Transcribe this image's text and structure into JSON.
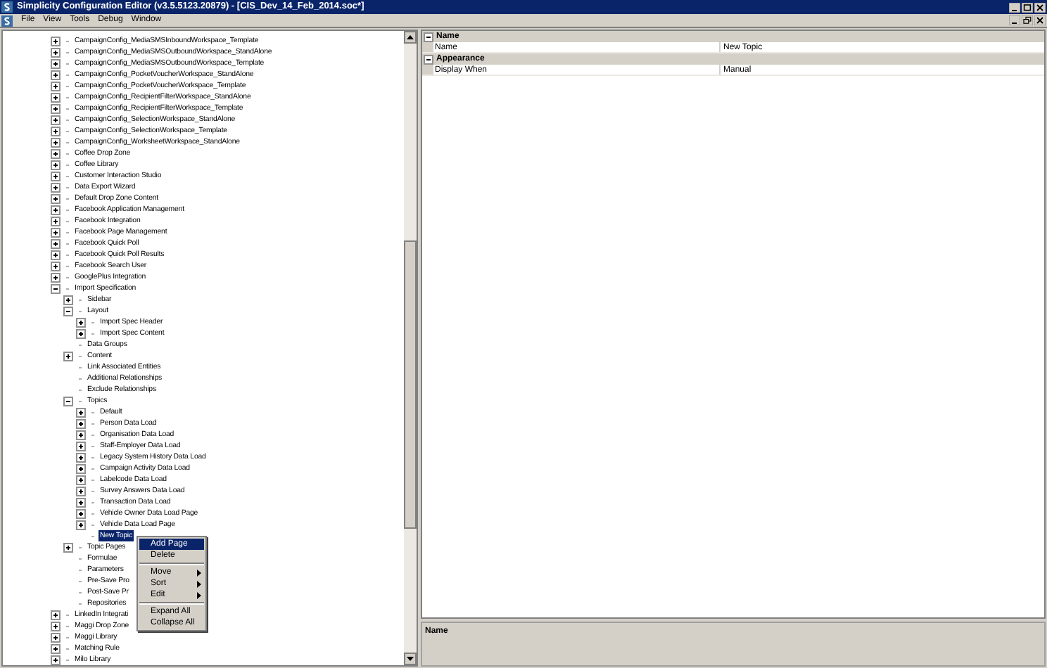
{
  "window": {
    "title": "Simplicity Configuration Editor (v3.5.5123.20879) - [CIS_Dev_14_Feb_2014.soc*]"
  },
  "menu": [
    "File",
    "View",
    "Tools",
    "Debug",
    "Window"
  ],
  "tree": [
    {
      "label": "CampaignConfig_MediaSMSInboundWorkspace_Template",
      "expanded": false,
      "selected": false
    },
    {
      "label": "CampaignConfig_MediaSMSOutboundWorkspace_StandAlone",
      "expanded": false,
      "selected": false
    },
    {
      "label": "CampaignConfig_MediaSMSOutboundWorkspace_Template",
      "expanded": false,
      "selected": false
    },
    {
      "label": "CampaignConfig_PocketVoucherWorkspace_StandAlone",
      "expanded": false,
      "selected": false
    },
    {
      "label": "CampaignConfig_PocketVoucherWorkspace_Template",
      "expanded": false,
      "selected": false
    },
    {
      "label": "CampaignConfig_RecipientFilterWorkspace_StandAlone",
      "expanded": false,
      "selected": false
    },
    {
      "label": "CampaignConfig_RecipientFilterWorkspace_Template",
      "expanded": false,
      "selected": false
    },
    {
      "label": "CampaignConfig_SelectionWorkspace_StandAlone",
      "expanded": false,
      "selected": false
    },
    {
      "label": "CampaignConfig_SelectionWorkspace_Template",
      "expanded": false,
      "selected": false
    },
    {
      "label": "CampaignConfig_WorksheetWorkspace_StandAlone",
      "expanded": false,
      "selected": false
    },
    {
      "label": "Coffee Drop Zone",
      "expanded": false,
      "selected": false
    },
    {
      "label": "Coffee Library",
      "expanded": false,
      "selected": false
    },
    {
      "label": "Customer Interaction Studio",
      "expanded": false,
      "selected": false
    },
    {
      "label": "Data Export Wizard",
      "expanded": false,
      "selected": false
    },
    {
      "label": "Default Drop Zone Content",
      "expanded": false,
      "selected": false
    },
    {
      "label": "Facebook Application Management",
      "expanded": false,
      "selected": false
    },
    {
      "label": "Facebook Integration",
      "expanded": false,
      "selected": false
    },
    {
      "label": "Facebook Page Management",
      "expanded": false,
      "selected": false
    },
    {
      "label": "Facebook Quick Poll",
      "expanded": false,
      "selected": false
    },
    {
      "label": "Facebook Quick Poll Results",
      "expanded": false,
      "selected": false
    },
    {
      "label": "Facebook Search User",
      "expanded": false,
      "selected": false
    },
    {
      "label": "GooglePlus Integration",
      "expanded": false,
      "selected": false
    },
    {
      "label": "Import Specification",
      "expanded": true,
      "selected": false,
      "children": [
        {
          "label": "Sidebar",
          "expanded": false,
          "selected": false
        },
        {
          "label": "Layout",
          "expanded": true,
          "selected": false,
          "children": [
            {
              "label": "Import Spec Header",
              "expanded": false,
              "selected": false
            },
            {
              "label": "Import Spec Content",
              "expanded": false,
              "selected": false
            }
          ]
        },
        {
          "label": "Data Groups",
          "selected": false
        },
        {
          "label": "Content",
          "expanded": false,
          "selected": false
        },
        {
          "label": "Link Associated Entities",
          "selected": false
        },
        {
          "label": "Additional Relationships",
          "selected": false
        },
        {
          "label": "Exclude Relationships",
          "selected": false
        },
        {
          "label": "Topics",
          "expanded": true,
          "selected": false,
          "children": [
            {
              "label": "Default",
              "expanded": false,
              "selected": false
            },
            {
              "label": "Person Data Load",
              "expanded": false,
              "selected": false
            },
            {
              "label": "Organisation Data Load",
              "expanded": false,
              "selected": false
            },
            {
              "label": "Staff-Employer Data Load",
              "expanded": false,
              "selected": false
            },
            {
              "label": "Legacy System History Data Load",
              "expanded": false,
              "selected": false
            },
            {
              "label": "Campaign Activity Data Load",
              "expanded": false,
              "selected": false
            },
            {
              "label": "Labelcode Data Load",
              "expanded": false,
              "selected": false
            },
            {
              "label": "Survey Answers Data Load",
              "expanded": false,
              "selected": false
            },
            {
              "label": "Transaction Data Load",
              "expanded": false,
              "selected": false
            },
            {
              "label": "Vehicle Owner Data Load Page",
              "expanded": false,
              "selected": false
            },
            {
              "label": "Vehicle Data Load Page",
              "expanded": false,
              "selected": false
            },
            {
              "label": "New Topic",
              "selected": true
            }
          ]
        },
        {
          "label": "Topic Pages",
          "expanded": false,
          "selected": false
        },
        {
          "label": "Formulae",
          "selected": false
        },
        {
          "label": "Parameters",
          "selected": false
        },
        {
          "label": "Pre-Save Pro",
          "selected": false
        },
        {
          "label": "Post-Save Pr",
          "selected": false
        },
        {
          "label": "Repositories",
          "selected": false
        }
      ]
    },
    {
      "label": "LinkedIn Integrati",
      "expanded": false,
      "selected": false
    },
    {
      "label": "Maggi Drop Zone",
      "expanded": false,
      "selected": false
    },
    {
      "label": "Maggi Library",
      "expanded": false,
      "selected": false
    },
    {
      "label": "Matching Rule",
      "expanded": false,
      "selected": false
    },
    {
      "label": "Milo Library",
      "expanded": false,
      "selected": false
    }
  ],
  "context_menu": [
    {
      "kind": "item",
      "label": "Add Page",
      "submenu": false,
      "selected": true
    },
    {
      "kind": "item",
      "label": "Delete",
      "submenu": false,
      "selected": false
    },
    {
      "kind": "separator"
    },
    {
      "kind": "item",
      "label": "Move",
      "submenu": true,
      "selected": false
    },
    {
      "kind": "item",
      "label": "Sort",
      "submenu": true,
      "selected": false
    },
    {
      "kind": "item",
      "label": "Edit",
      "submenu": true,
      "selected": false
    },
    {
      "kind": "separator"
    },
    {
      "kind": "item",
      "label": "Expand All",
      "submenu": false,
      "selected": false
    },
    {
      "kind": "item",
      "label": "Collapse All",
      "submenu": false,
      "selected": false
    }
  ],
  "properties": [
    {
      "category": "Name",
      "expanded": true,
      "rows": [
        {
          "name": "Name",
          "value": "New Topic"
        }
      ]
    },
    {
      "category": "Appearance",
      "expanded": true,
      "rows": [
        {
          "name": "Display When",
          "value": "Manual"
        }
      ]
    }
  ],
  "help_panel": {
    "title": "Name"
  }
}
